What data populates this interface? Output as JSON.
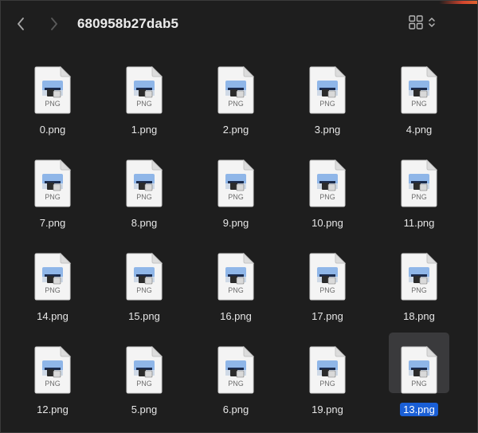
{
  "window": {
    "folder_title": "680958b27dab5"
  },
  "toolbar": {
    "back_icon": "chevron-left-icon",
    "forward_icon": "chevron-right-icon",
    "view_icon": "grid-view-icon",
    "view_menu_icon": "up-down-chevron-icon"
  },
  "files": {
    "type_badge": "PNG",
    "items": [
      {
        "name": "0.png"
      },
      {
        "name": "1.png"
      },
      {
        "name": "2.png"
      },
      {
        "name": "3.png"
      },
      {
        "name": "4.png"
      },
      {
        "name": "7.png"
      },
      {
        "name": "8.png"
      },
      {
        "name": "9.png"
      },
      {
        "name": "10.png"
      },
      {
        "name": "11.png"
      },
      {
        "name": "14.png"
      },
      {
        "name": "15.png"
      },
      {
        "name": "16.png"
      },
      {
        "name": "17.png"
      },
      {
        "name": "18.png"
      },
      {
        "name": "12.png"
      },
      {
        "name": "5.png"
      },
      {
        "name": "6.png"
      },
      {
        "name": "19.png"
      },
      {
        "name": "13.png"
      }
    ],
    "selected": "13.png"
  },
  "colors": {
    "background": "#1e1e1e",
    "selection": "#1a5fd6",
    "tile_highlight": "#3a3a3c"
  }
}
